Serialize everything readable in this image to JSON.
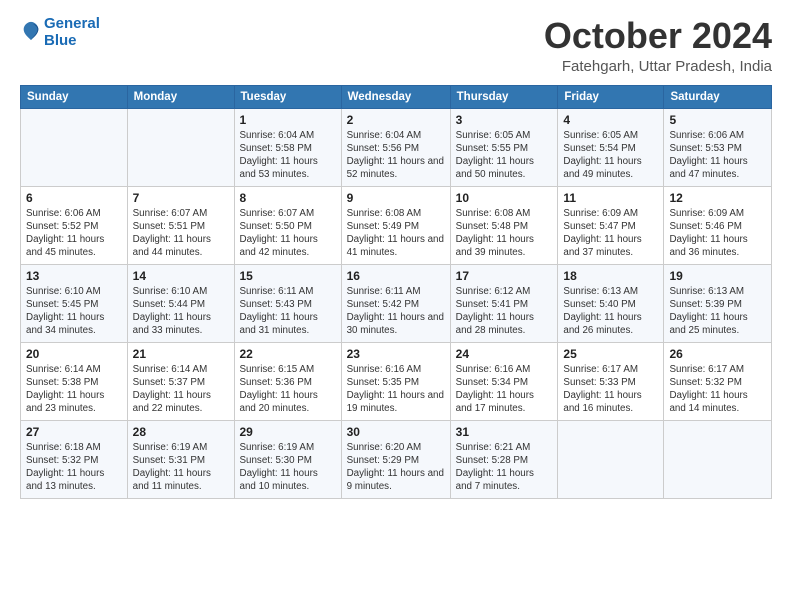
{
  "logo": {
    "line1": "General",
    "line2": "Blue"
  },
  "title": "October 2024",
  "subtitle": "Fatehgarh, Uttar Pradesh, India",
  "weekdays": [
    "Sunday",
    "Monday",
    "Tuesday",
    "Wednesday",
    "Thursday",
    "Friday",
    "Saturday"
  ],
  "weeks": [
    [
      {
        "day": "",
        "detail": ""
      },
      {
        "day": "",
        "detail": ""
      },
      {
        "day": "1",
        "detail": "Sunrise: 6:04 AM\nSunset: 5:58 PM\nDaylight: 11 hours and 53 minutes."
      },
      {
        "day": "2",
        "detail": "Sunrise: 6:04 AM\nSunset: 5:56 PM\nDaylight: 11 hours and 52 minutes."
      },
      {
        "day": "3",
        "detail": "Sunrise: 6:05 AM\nSunset: 5:55 PM\nDaylight: 11 hours and 50 minutes."
      },
      {
        "day": "4",
        "detail": "Sunrise: 6:05 AM\nSunset: 5:54 PM\nDaylight: 11 hours and 49 minutes."
      },
      {
        "day": "5",
        "detail": "Sunrise: 6:06 AM\nSunset: 5:53 PM\nDaylight: 11 hours and 47 minutes."
      }
    ],
    [
      {
        "day": "6",
        "detail": "Sunrise: 6:06 AM\nSunset: 5:52 PM\nDaylight: 11 hours and 45 minutes."
      },
      {
        "day": "7",
        "detail": "Sunrise: 6:07 AM\nSunset: 5:51 PM\nDaylight: 11 hours and 44 minutes."
      },
      {
        "day": "8",
        "detail": "Sunrise: 6:07 AM\nSunset: 5:50 PM\nDaylight: 11 hours and 42 minutes."
      },
      {
        "day": "9",
        "detail": "Sunrise: 6:08 AM\nSunset: 5:49 PM\nDaylight: 11 hours and 41 minutes."
      },
      {
        "day": "10",
        "detail": "Sunrise: 6:08 AM\nSunset: 5:48 PM\nDaylight: 11 hours and 39 minutes."
      },
      {
        "day": "11",
        "detail": "Sunrise: 6:09 AM\nSunset: 5:47 PM\nDaylight: 11 hours and 37 minutes."
      },
      {
        "day": "12",
        "detail": "Sunrise: 6:09 AM\nSunset: 5:46 PM\nDaylight: 11 hours and 36 minutes."
      }
    ],
    [
      {
        "day": "13",
        "detail": "Sunrise: 6:10 AM\nSunset: 5:45 PM\nDaylight: 11 hours and 34 minutes."
      },
      {
        "day": "14",
        "detail": "Sunrise: 6:10 AM\nSunset: 5:44 PM\nDaylight: 11 hours and 33 minutes."
      },
      {
        "day": "15",
        "detail": "Sunrise: 6:11 AM\nSunset: 5:43 PM\nDaylight: 11 hours and 31 minutes."
      },
      {
        "day": "16",
        "detail": "Sunrise: 6:11 AM\nSunset: 5:42 PM\nDaylight: 11 hours and 30 minutes."
      },
      {
        "day": "17",
        "detail": "Sunrise: 6:12 AM\nSunset: 5:41 PM\nDaylight: 11 hours and 28 minutes."
      },
      {
        "day": "18",
        "detail": "Sunrise: 6:13 AM\nSunset: 5:40 PM\nDaylight: 11 hours and 26 minutes."
      },
      {
        "day": "19",
        "detail": "Sunrise: 6:13 AM\nSunset: 5:39 PM\nDaylight: 11 hours and 25 minutes."
      }
    ],
    [
      {
        "day": "20",
        "detail": "Sunrise: 6:14 AM\nSunset: 5:38 PM\nDaylight: 11 hours and 23 minutes."
      },
      {
        "day": "21",
        "detail": "Sunrise: 6:14 AM\nSunset: 5:37 PM\nDaylight: 11 hours and 22 minutes."
      },
      {
        "day": "22",
        "detail": "Sunrise: 6:15 AM\nSunset: 5:36 PM\nDaylight: 11 hours and 20 minutes."
      },
      {
        "day": "23",
        "detail": "Sunrise: 6:16 AM\nSunset: 5:35 PM\nDaylight: 11 hours and 19 minutes."
      },
      {
        "day": "24",
        "detail": "Sunrise: 6:16 AM\nSunset: 5:34 PM\nDaylight: 11 hours and 17 minutes."
      },
      {
        "day": "25",
        "detail": "Sunrise: 6:17 AM\nSunset: 5:33 PM\nDaylight: 11 hours and 16 minutes."
      },
      {
        "day": "26",
        "detail": "Sunrise: 6:17 AM\nSunset: 5:32 PM\nDaylight: 11 hours and 14 minutes."
      }
    ],
    [
      {
        "day": "27",
        "detail": "Sunrise: 6:18 AM\nSunset: 5:32 PM\nDaylight: 11 hours and 13 minutes."
      },
      {
        "day": "28",
        "detail": "Sunrise: 6:19 AM\nSunset: 5:31 PM\nDaylight: 11 hours and 11 minutes."
      },
      {
        "day": "29",
        "detail": "Sunrise: 6:19 AM\nSunset: 5:30 PM\nDaylight: 11 hours and 10 minutes."
      },
      {
        "day": "30",
        "detail": "Sunrise: 6:20 AM\nSunset: 5:29 PM\nDaylight: 11 hours and 9 minutes."
      },
      {
        "day": "31",
        "detail": "Sunrise: 6:21 AM\nSunset: 5:28 PM\nDaylight: 11 hours and 7 minutes."
      },
      {
        "day": "",
        "detail": ""
      },
      {
        "day": "",
        "detail": ""
      }
    ]
  ]
}
